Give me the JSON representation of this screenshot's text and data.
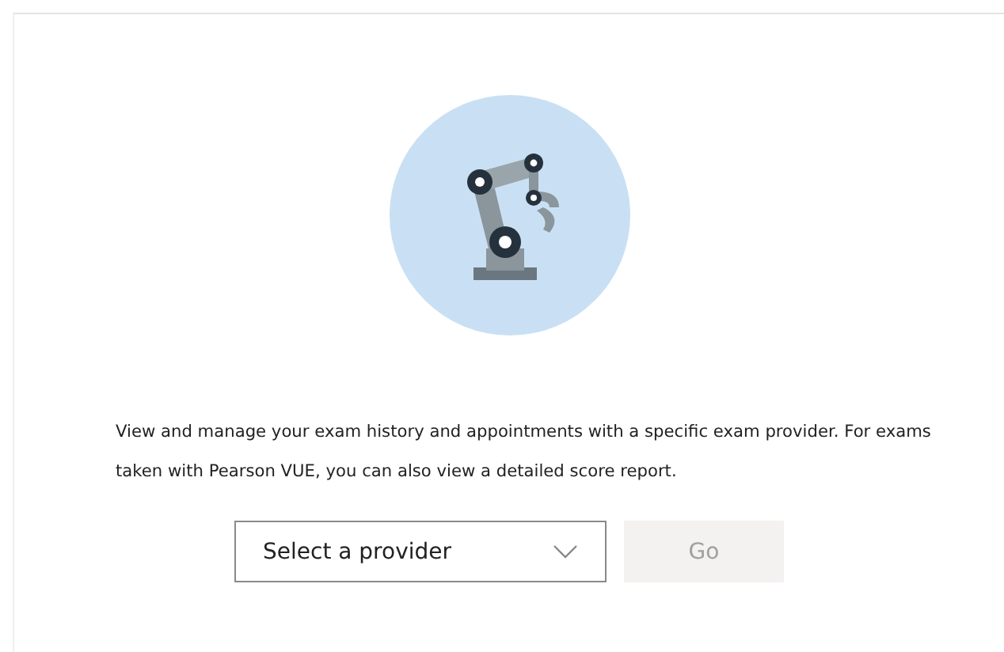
{
  "description": "View and manage your exam history and appointments with a specific exam provider. For exams taken with Pearson VUE, you can also view a detailed score report.",
  "provider_select": {
    "placeholder": "Select a provider"
  },
  "go_button": {
    "label": "Go",
    "disabled": true
  }
}
